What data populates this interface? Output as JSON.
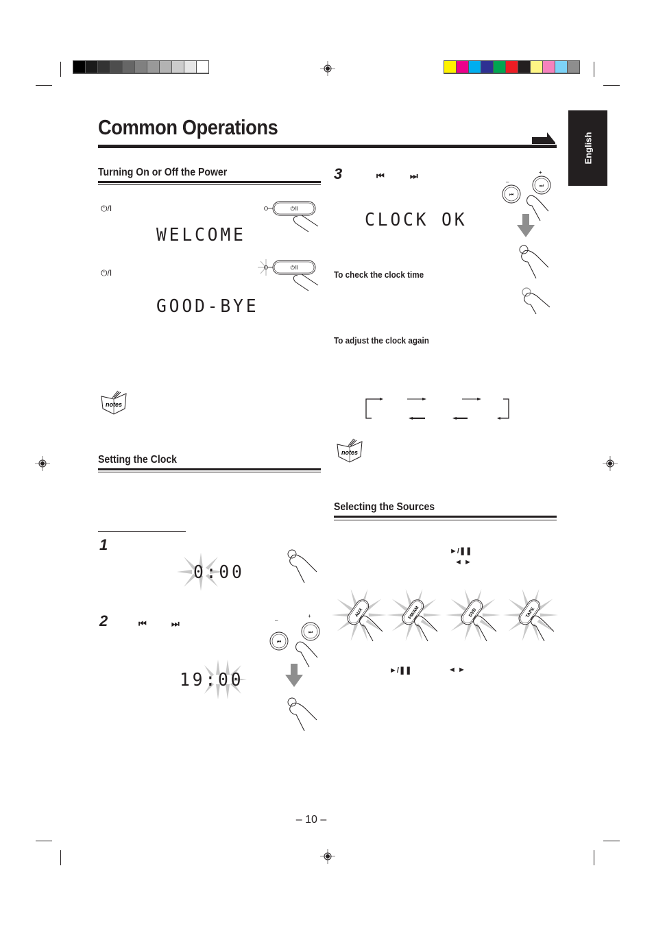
{
  "page": {
    "title": "Common Operations",
    "language_tab": "English",
    "page_number": "– 10 –"
  },
  "print_marks": {
    "grayscale_swatches": [
      "#000000",
      "#1a1a1a",
      "#333333",
      "#4d4d4d",
      "#666666",
      "#808080",
      "#999999",
      "#b3b3b3",
      "#cccccc",
      "#e6e6e6",
      "#ffffff"
    ],
    "color_swatches": [
      "#fff200",
      "#ec008c",
      "#00aeef",
      "#2e3192",
      "#00a651",
      "#ed1c24",
      "#231f20",
      "#fff685",
      "#f682bd",
      "#7dd3f7",
      "#8e8e8e"
    ]
  },
  "sections": {
    "power": {
      "heading": "Turning On or Off the Power",
      "power_symbol": "⏻/I",
      "display_on": "WELCOME",
      "display_off": "GOOD-BYE",
      "button_label": "⏻/I"
    },
    "clock": {
      "heading": "Setting the Clock",
      "step1": {
        "number": "1",
        "display": "0:00"
      },
      "step2": {
        "number": "2",
        "prev_symbol": "⏮",
        "next_symbol": "⏭",
        "display": "19:00"
      },
      "step3": {
        "number": "3",
        "prev_symbol": "⏮",
        "next_symbol": "⏭",
        "display": "CLOCK OK"
      },
      "check_heading": "To check the clock time",
      "adjust_heading": "To adjust the clock again"
    },
    "sources": {
      "heading": "Selecting the Sources",
      "play_pause_symbol": "►/❚❚",
      "tape_symbol": "◄ ►",
      "buttons": [
        "AUX",
        "FM/AM",
        "DVD",
        "TAPE"
      ],
      "footer_play_pause": "►/❚❚",
      "footer_tape": "◄ ►"
    }
  }
}
